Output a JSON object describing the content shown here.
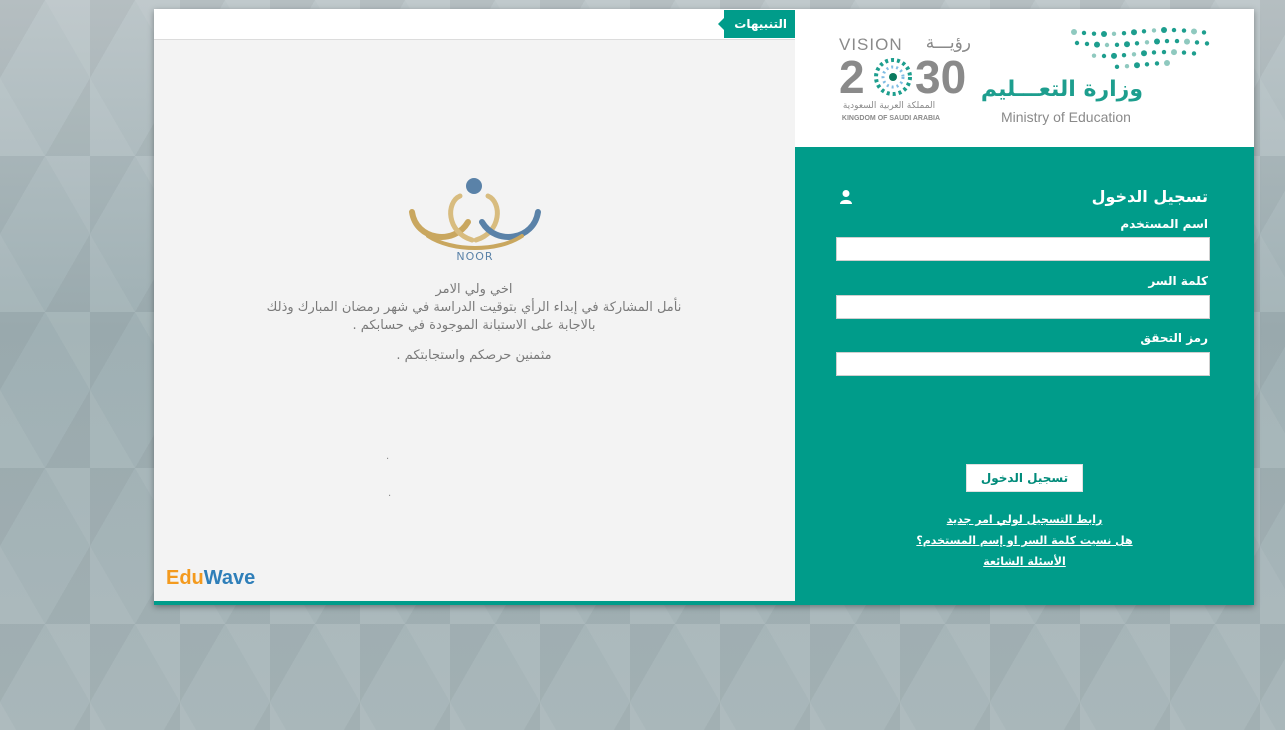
{
  "notices": {
    "tab_label": "التنبيهات",
    "noor_label": "NOOR",
    "greeting": "اخي ولي الامر",
    "line1": "نأمل المشاركة في إبداء الرأي بتوقيت الدراسة في شهر رمضان المبارك وذلك",
    "line2": "بالاجابة على الاستبانة الموجودة في حسابكم .",
    "thanks": "مثمنين حرصكم واستجابتكم .",
    "dot1": ".",
    "dot2": "."
  },
  "eduwave": {
    "part1": "Edu",
    "part2": "Wave"
  },
  "vision": {
    "word": "VISION",
    "arabic": "رؤيـــة",
    "year_left": "2",
    "year_right": "30",
    "kingdom_ar": "المملكة العربية السعودية",
    "kingdom_en": "KINGDOM OF SAUDI ARABIA"
  },
  "ministry": {
    "name_ar": "وزارة التعـــليم",
    "name_en": "Ministry of Education"
  },
  "login": {
    "title": "تسجيل الدخول",
    "username_label": "اسم المستخدم",
    "password_label": "كلمة السر",
    "captcha_label": "رمز التحقق",
    "username_value": "",
    "password_value": "",
    "captcha_value": "",
    "submit_label": "تسجيل الدخول",
    "register_link": "رابط التسجيل لولي امر جديد",
    "forgot_link": "هل نسيت كلمة السر او إسم المستخدم؟",
    "faq_link": "الأسئلة الشائعة"
  },
  "colors": {
    "teal": "#009c8a",
    "gold": "#c9a75f",
    "blue": "#5a82a8"
  }
}
